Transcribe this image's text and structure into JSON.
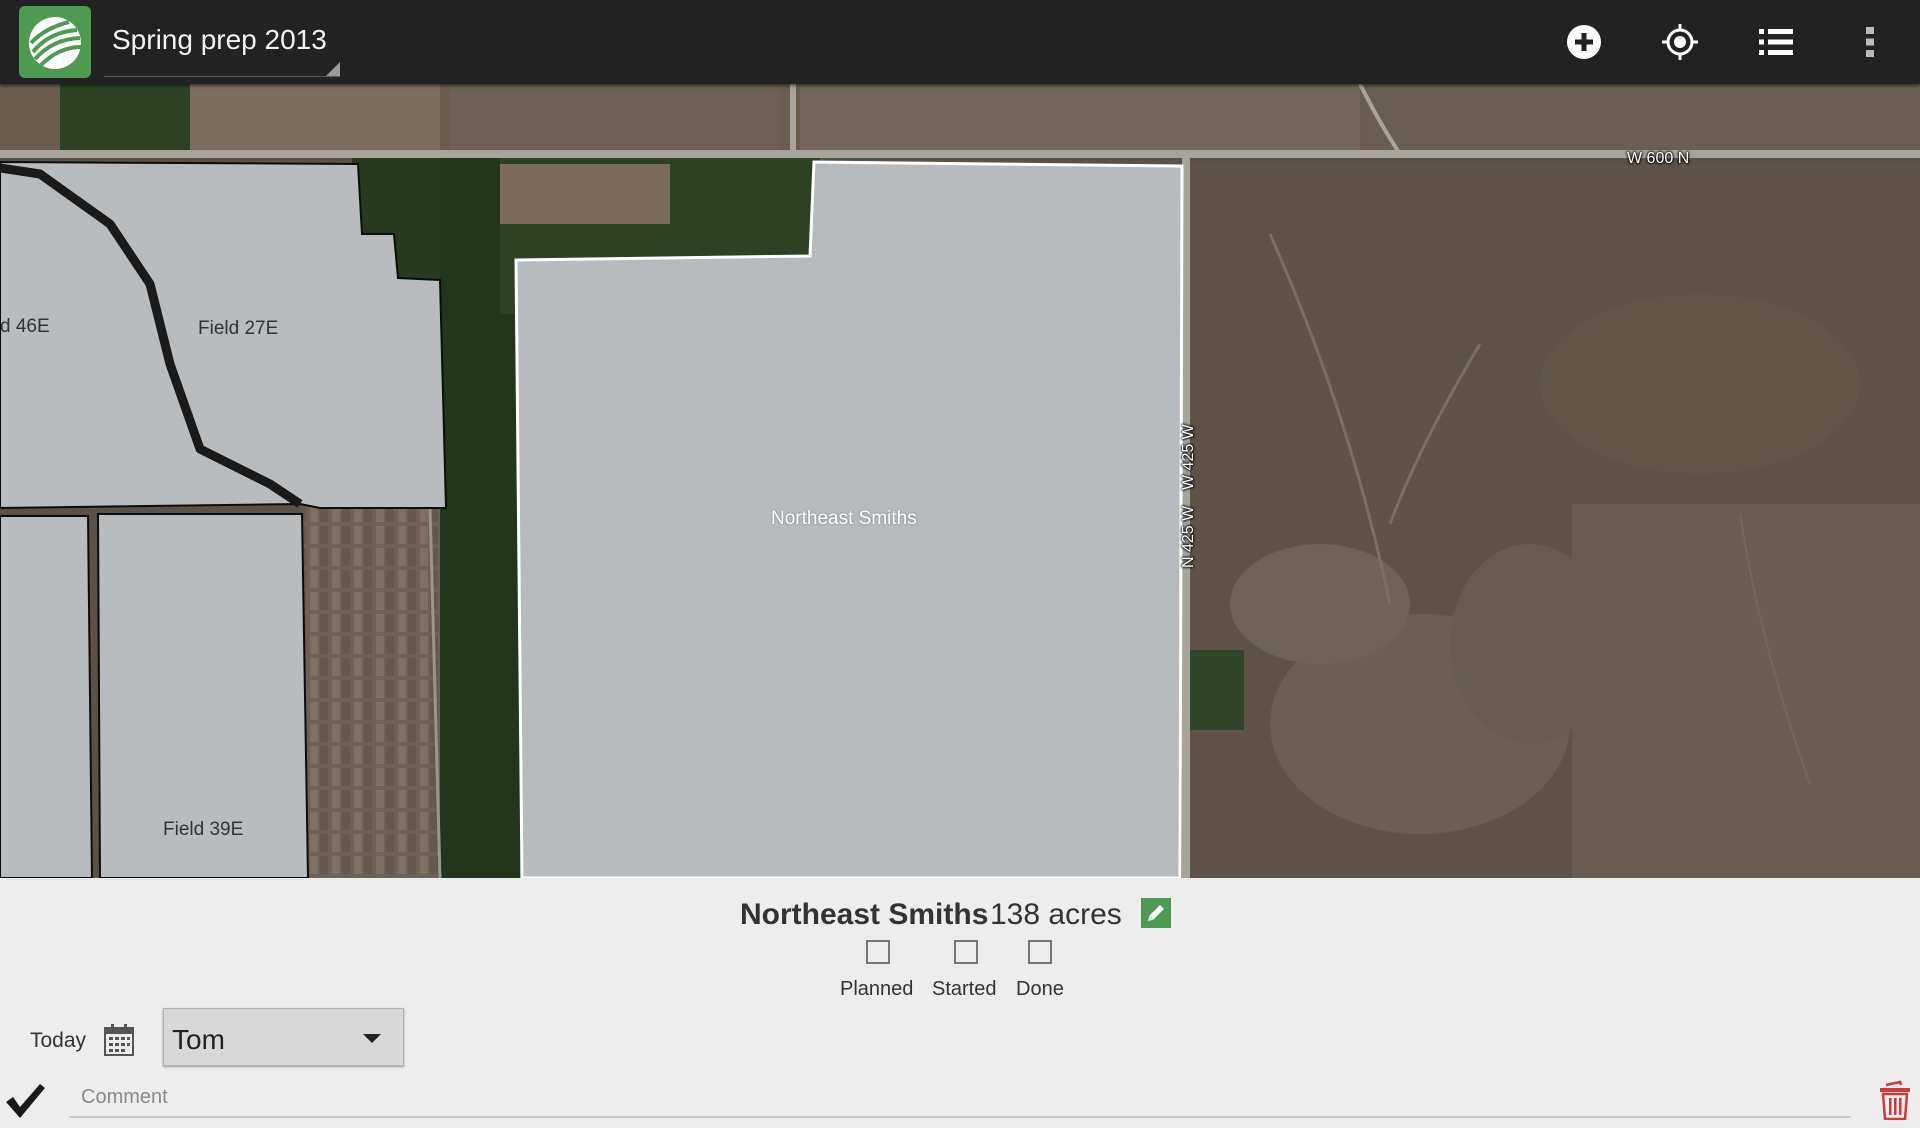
{
  "actionbar": {
    "app_icon": "farm-field-logo-icon",
    "title": "Spring prep 2013",
    "actions": [
      {
        "name": "add-icon"
      },
      {
        "name": "my-location-icon"
      },
      {
        "name": "list-icon"
      },
      {
        "name": "overflow-menu-icon"
      }
    ]
  },
  "map": {
    "fields": [
      {
        "label": "d 46E"
      },
      {
        "label": "Field 27E"
      },
      {
        "label": "Field 39E"
      },
      {
        "label": "Northeast Smiths"
      }
    ],
    "roads": [
      "W 600 N",
      "N 425 W",
      "W 425 W"
    ]
  },
  "details": {
    "field_name": "Northeast Smiths",
    "acres": "138 acres",
    "statuses": [
      {
        "label": "Planned",
        "checked": false
      },
      {
        "label": "Started",
        "checked": false
      },
      {
        "label": "Done",
        "checked": false
      }
    ],
    "date_label": "Today",
    "assignee": "Tom",
    "comment_placeholder": "Comment",
    "comment_value": ""
  },
  "colors": {
    "action_bar": "#222222",
    "field_overlay": "#b9bcbf",
    "panel_background": "#ededed",
    "accent_green": "#4e9a52",
    "delete_red": "#cc3b3b"
  }
}
